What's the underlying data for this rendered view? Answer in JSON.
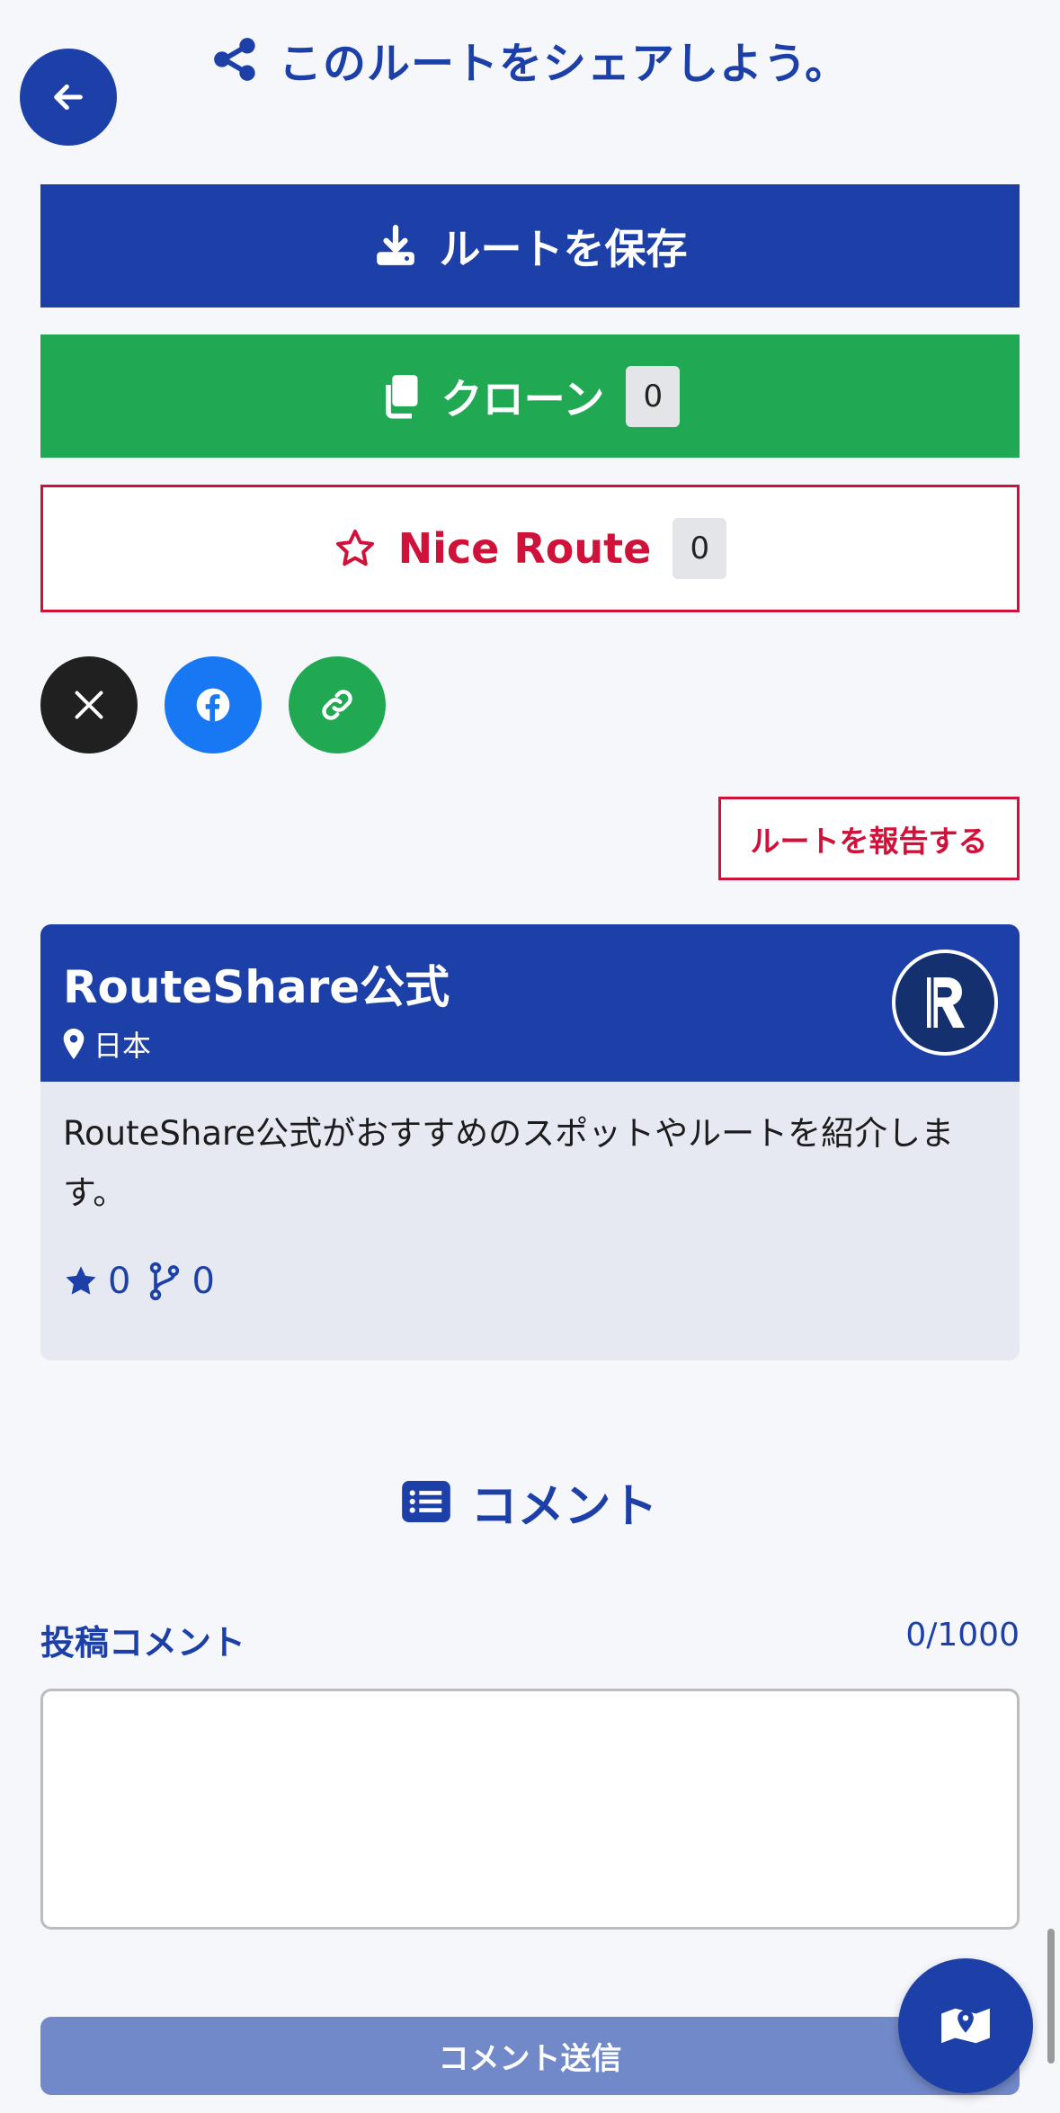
{
  "header": {
    "back_icon": "arrow-left-icon",
    "share_icon": "share-icon",
    "title": "このルートをシェアしよう。"
  },
  "actions": {
    "save_label": "ルートを保存",
    "save_icon": "download-icon",
    "clone_label": "クローン",
    "clone_icon": "copy-icon",
    "clone_count": "0",
    "nice_label": "Nice Route",
    "nice_icon": "star-outline-icon",
    "nice_count": "0"
  },
  "social": {
    "x_icon": "x-icon",
    "facebook_icon": "facebook-icon",
    "link_icon": "link-icon"
  },
  "report": {
    "label": "ルートを報告する"
  },
  "profile": {
    "name": "RouteShare公式",
    "location": "日本",
    "location_icon": "map-pin-icon",
    "avatar_letter": "R",
    "description": "RouteShare公式がおすすめのスポットやルートを紹介します。",
    "stars": "0",
    "forks": "0"
  },
  "comments": {
    "title": "コメント",
    "title_icon": "list-icon",
    "label": "投稿コメント",
    "counter": "0/1000",
    "input_value": "",
    "submit_label": "コメント送信"
  },
  "fab": {
    "icon": "map-icon"
  },
  "colors": {
    "primary": "#1d40a8",
    "green": "#21a853",
    "red": "#d0123a",
    "facebook": "#1877f2",
    "x": "#202020",
    "submit_disabled": "#7289c9"
  }
}
